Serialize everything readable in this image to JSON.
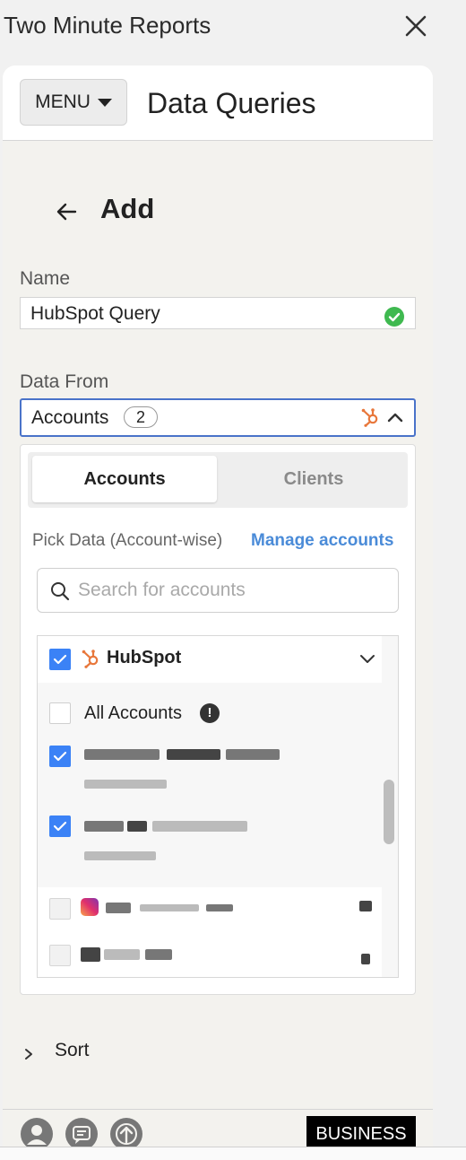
{
  "app": {
    "title": "Two Minute Reports"
  },
  "header": {
    "menu_label": "MENU",
    "title": "Data Queries"
  },
  "page": {
    "section_title": "Add"
  },
  "name_field": {
    "label": "Name",
    "value": "HubSpot Query"
  },
  "data_from": {
    "label": "Data From",
    "value": "Accounts",
    "count": "2",
    "tabs": [
      {
        "label": "Accounts",
        "active": true
      },
      {
        "label": "Clients",
        "active": false
      }
    ],
    "pick_label": "Pick Data (Account-wise)",
    "manage_link": "Manage accounts",
    "search_placeholder": "Search for accounts",
    "group": {
      "label": "HubSpot",
      "checked": true
    },
    "all_accounts": {
      "label": "All Accounts",
      "checked": false
    },
    "accounts": [
      {
        "checked": true,
        "obscured": true
      },
      {
        "checked": true,
        "obscured": true
      },
      {
        "checked": false,
        "obscured": true
      },
      {
        "checked": false,
        "obscured": true
      }
    ]
  },
  "sort": {
    "label": "Sort"
  },
  "footer": {
    "badge": "BUSINESS"
  },
  "colors": {
    "accent": "#3b82f6",
    "link": "#4a8bd8",
    "focus_border": "#4a73c9",
    "success": "#3fb950",
    "hubspot": "#e8773b"
  }
}
